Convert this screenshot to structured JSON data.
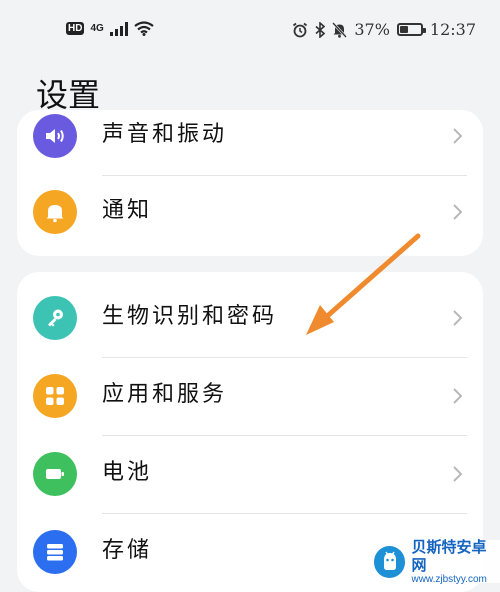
{
  "status_bar": {
    "hd": "HD",
    "network": "4G",
    "battery_percent": "37%",
    "battery_level": 0.37,
    "time": "12:37",
    "icons": [
      "signal-icon",
      "wifi-icon",
      "alarm-icon",
      "bluetooth-icon",
      "mute-bell-icon",
      "battery-icon"
    ]
  },
  "page": {
    "title": "设置"
  },
  "groups": [
    {
      "items": [
        {
          "label": "声音和振动",
          "icon": "sound-icon",
          "color": "#6a5ae0"
        },
        {
          "label": "通知",
          "icon": "bell-icon",
          "color": "#f5a623"
        }
      ]
    },
    {
      "items": [
        {
          "label": "生物识别和密码",
          "icon": "key-icon",
          "color": "#3cc3b3"
        },
        {
          "label": "应用和服务",
          "icon": "apps-icon",
          "color": "#f5a623"
        },
        {
          "label": "电池",
          "icon": "battery-icon",
          "color": "#3ec05e"
        },
        {
          "label": "存储",
          "icon": "storage-icon",
          "color": "#2b6ef0"
        }
      ]
    }
  ],
  "annotation": {
    "arrow_color": "#f08a2e"
  },
  "watermark": {
    "title": "贝斯特安卓网",
    "url": "www.zjbstyy.com"
  }
}
